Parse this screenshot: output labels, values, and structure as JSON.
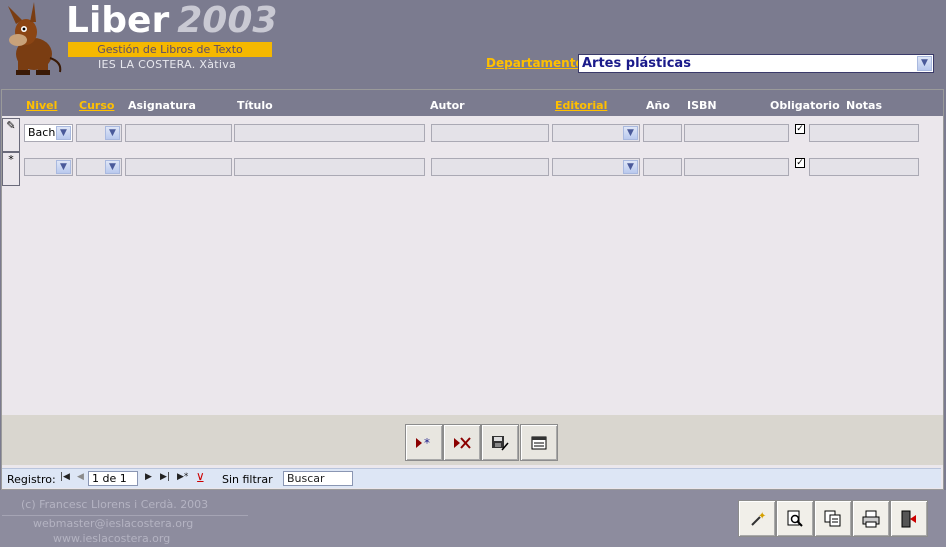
{
  "header": {
    "app_name": "Liber",
    "app_year": "2003",
    "subtitle": "Gestión de Libros de Texto",
    "school": "IES LA COSTERA. Xàtiva",
    "department_label": "Departamento",
    "department_value": "Artes plásticas"
  },
  "table": {
    "columns": [
      "Nivel",
      "Curso",
      "Asignatura",
      "Título",
      "Autor",
      "Editorial",
      "Año",
      "ISBN",
      "Obligatorio",
      "Notas"
    ],
    "rows": [
      {
        "selector": "✎",
        "nivel": "Bach",
        "curso": "",
        "asignatura": "",
        "titulo": "",
        "autor": "",
        "editorial": "",
        "anio": "",
        "isbn": "",
        "obligatorio": true,
        "notas": ""
      },
      {
        "selector": "*",
        "nivel": "",
        "curso": "",
        "asignatura": "",
        "titulo": "",
        "autor": "",
        "editorial": "",
        "anio": "",
        "isbn": "",
        "obligatorio": true,
        "notas": ""
      }
    ]
  },
  "toolbar": {
    "buttons": [
      "new-record-icon",
      "delete-record-icon",
      "save-record-icon",
      "form-view-icon"
    ]
  },
  "navigation": {
    "label": "Registro:",
    "position": "1 de 1",
    "filter_status": "Sin filtrar",
    "search_placeholder": "Buscar"
  },
  "footer": {
    "copyright": "(c) Francesc Llorens i Cerdà. 2003",
    "email": "webmaster@ieslacostera.org",
    "website": "www.ieslacostera.org",
    "buttons": [
      "wizard-icon",
      "print-preview-icon",
      "copy-report-icon",
      "print-icon",
      "exit-icon"
    ]
  },
  "colors": {
    "background": "#7b7b8f",
    "accent": "#ffc000",
    "form": "#ebe7ec"
  }
}
